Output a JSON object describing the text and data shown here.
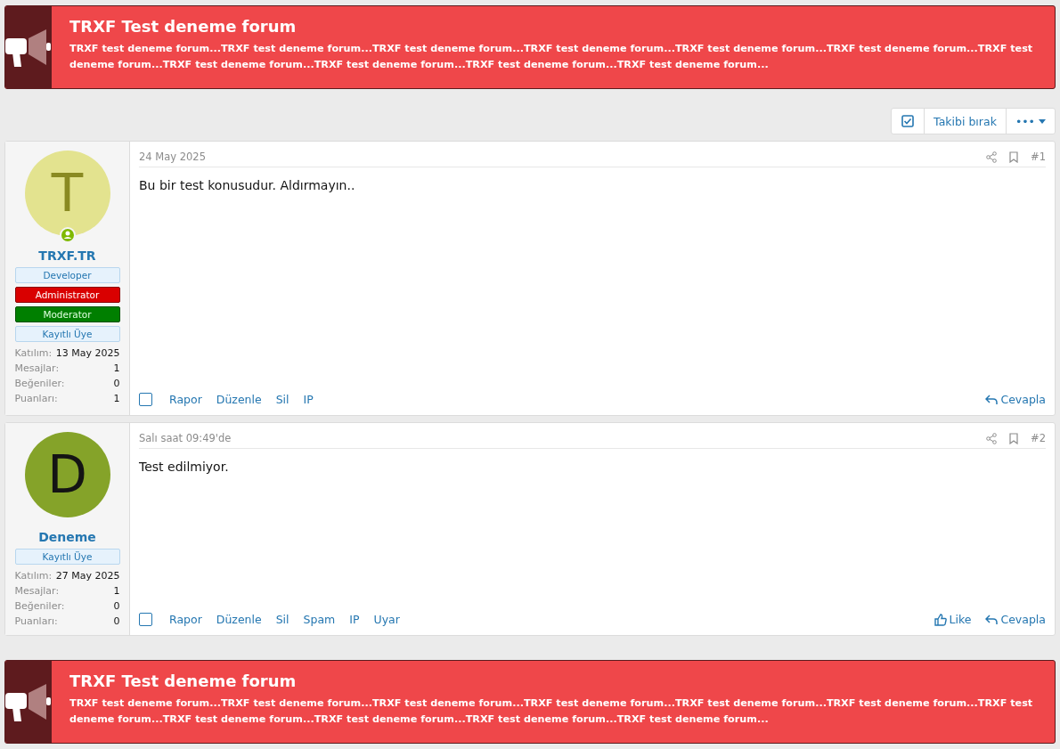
{
  "notices": [
    {
      "title": "TRXF Test deneme forum",
      "text": "TRXF test deneme forum...TRXF test deneme forum...TRXF test deneme forum...TRXF test deneme forum...TRXF test deneme forum...TRXF test deneme forum...TRXF test deneme forum...TRXF test deneme forum...TRXF test deneme forum...TRXF test deneme forum...TRXF test deneme forum..."
    }
  ],
  "toolbar": {
    "watch_checked": true,
    "unwatch_label": "Takibi bırak",
    "more_label": "•••"
  },
  "posts": [
    {
      "avatar_letter": "T",
      "color": "#e3e38f",
      "online": true,
      "username": "TRXF.TR",
      "badges": [
        {
          "label": "Developer",
          "kind": "default"
        },
        {
          "label": "Administrator",
          "kind": "admin"
        },
        {
          "label": "Moderator",
          "kind": "mod"
        },
        {
          "label": "Kayıtlı Üye",
          "kind": "default"
        }
      ],
      "stats": [
        {
          "label": "Katılım:",
          "value": "13 May 2025"
        },
        {
          "label": "Mesajlar:",
          "value": "1"
        },
        {
          "label": "Beğeniler:",
          "value": "0"
        },
        {
          "label": "Puanları:",
          "value": "1"
        }
      ],
      "date": "24 May 2025",
      "number": "#1",
      "body": "Bu bir test konusudur. Aldırmayın..",
      "checked": false,
      "actions": [
        "Rapor",
        "Düzenle",
        "Sil",
        "IP"
      ],
      "right_actions": [
        {
          "kind": "reply",
          "label": "Cevapla"
        }
      ]
    },
    {
      "avatar_letter": "D",
      "color": "#85a329",
      "online": false,
      "username": "Deneme",
      "badges": [
        {
          "label": "Kayıtlı Üye",
          "kind": "default"
        }
      ],
      "stats": [
        {
          "label": "Katılım:",
          "value": "27 May 2025"
        },
        {
          "label": "Mesajlar:",
          "value": "1"
        },
        {
          "label": "Beğeniler:",
          "value": "0"
        },
        {
          "label": "Puanları:",
          "value": "0"
        }
      ],
      "date": "Salı saat 09:49'de",
      "number": "#2",
      "body": "Test edilmiyor.",
      "checked": false,
      "actions": [
        "Rapor",
        "Düzenle",
        "Sil",
        "Spam",
        "IP",
        "Uyar"
      ],
      "right_actions": [
        {
          "kind": "like",
          "label": "Like"
        },
        {
          "kind": "reply",
          "label": "Cevapla"
        }
      ]
    }
  ],
  "bottom_notices": [
    {
      "title": "TRXF Test deneme forum",
      "text": "TRXF test deneme forum...TRXF test deneme forum...TRXF test deneme forum...TRXF test deneme forum...TRXF test deneme forum...TRXF test deneme forum...TRXF test deneme forum...TRXF test deneme forum...TRXF test deneme forum...TRXF test deneme forum...TRXF test deneme forum..."
    }
  ]
}
